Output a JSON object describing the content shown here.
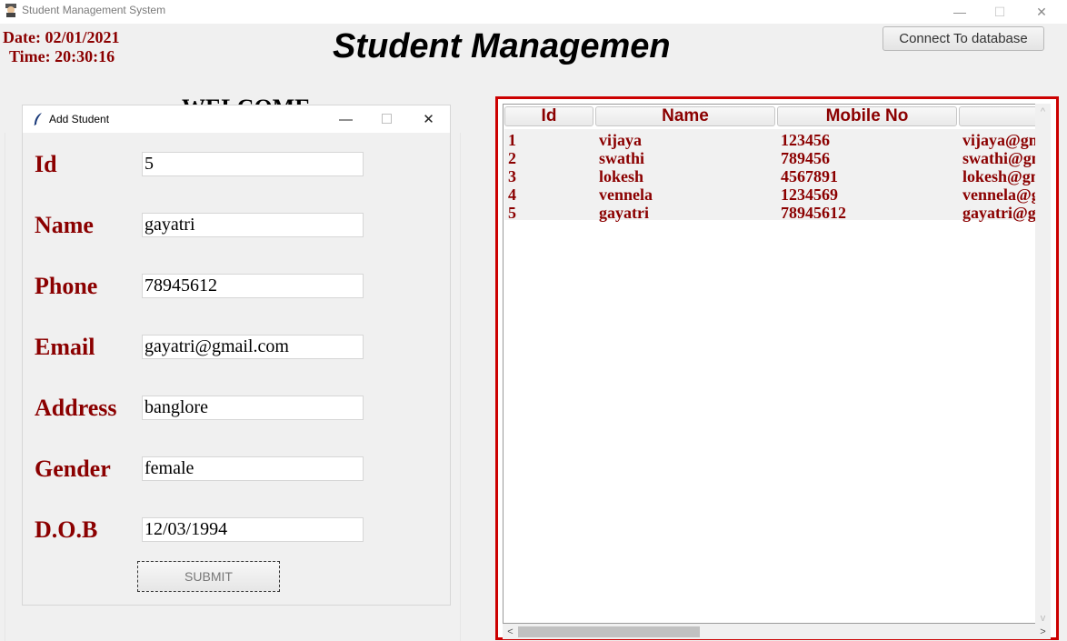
{
  "window": {
    "title": "Student Management System",
    "minimize": "—",
    "maximize": "☐",
    "close": "✕"
  },
  "header": {
    "date": "Date: 02/01/2021",
    "time": "Time: 20:30:16",
    "title": "Student Managemen",
    "connect_button": "Connect To database",
    "welcome": "WELCOME"
  },
  "dialog": {
    "title": "Add Student",
    "minimize": "—",
    "maximize": "☐",
    "close": "✕",
    "fields": [
      {
        "label": "Id",
        "value": "5"
      },
      {
        "label": "Name",
        "value": "gayatri"
      },
      {
        "label": "Phone",
        "value": "78945612"
      },
      {
        "label": "Email",
        "value": "gayatri@gmail.com"
      },
      {
        "label": "Address",
        "value": "banglore"
      },
      {
        "label": "Gender",
        "value": "female"
      },
      {
        "label": "D.O.B",
        "value": "12/03/1994"
      }
    ],
    "submit": "SUBMIT"
  },
  "table": {
    "columns": [
      "Id",
      "Name",
      "Mobile No",
      ""
    ],
    "rows": [
      [
        "1",
        "vijaya",
        "123456",
        "vijaya@gm"
      ],
      [
        "2",
        "swathi",
        "789456",
        "swathi@gm"
      ],
      [
        "3",
        "lokesh",
        "4567891",
        "lokesh@gm"
      ],
      [
        "4",
        "vennela",
        "1234569",
        "vennela@gm"
      ],
      [
        "5",
        "gayatri",
        "78945612",
        "gayatri@gm"
      ]
    ],
    "scroll_left": "<",
    "scroll_right": ">",
    "scroll_up": "^",
    "scroll_down": "v"
  },
  "colors": {
    "accent": "#8b0000",
    "table_border": "#cc0000"
  }
}
